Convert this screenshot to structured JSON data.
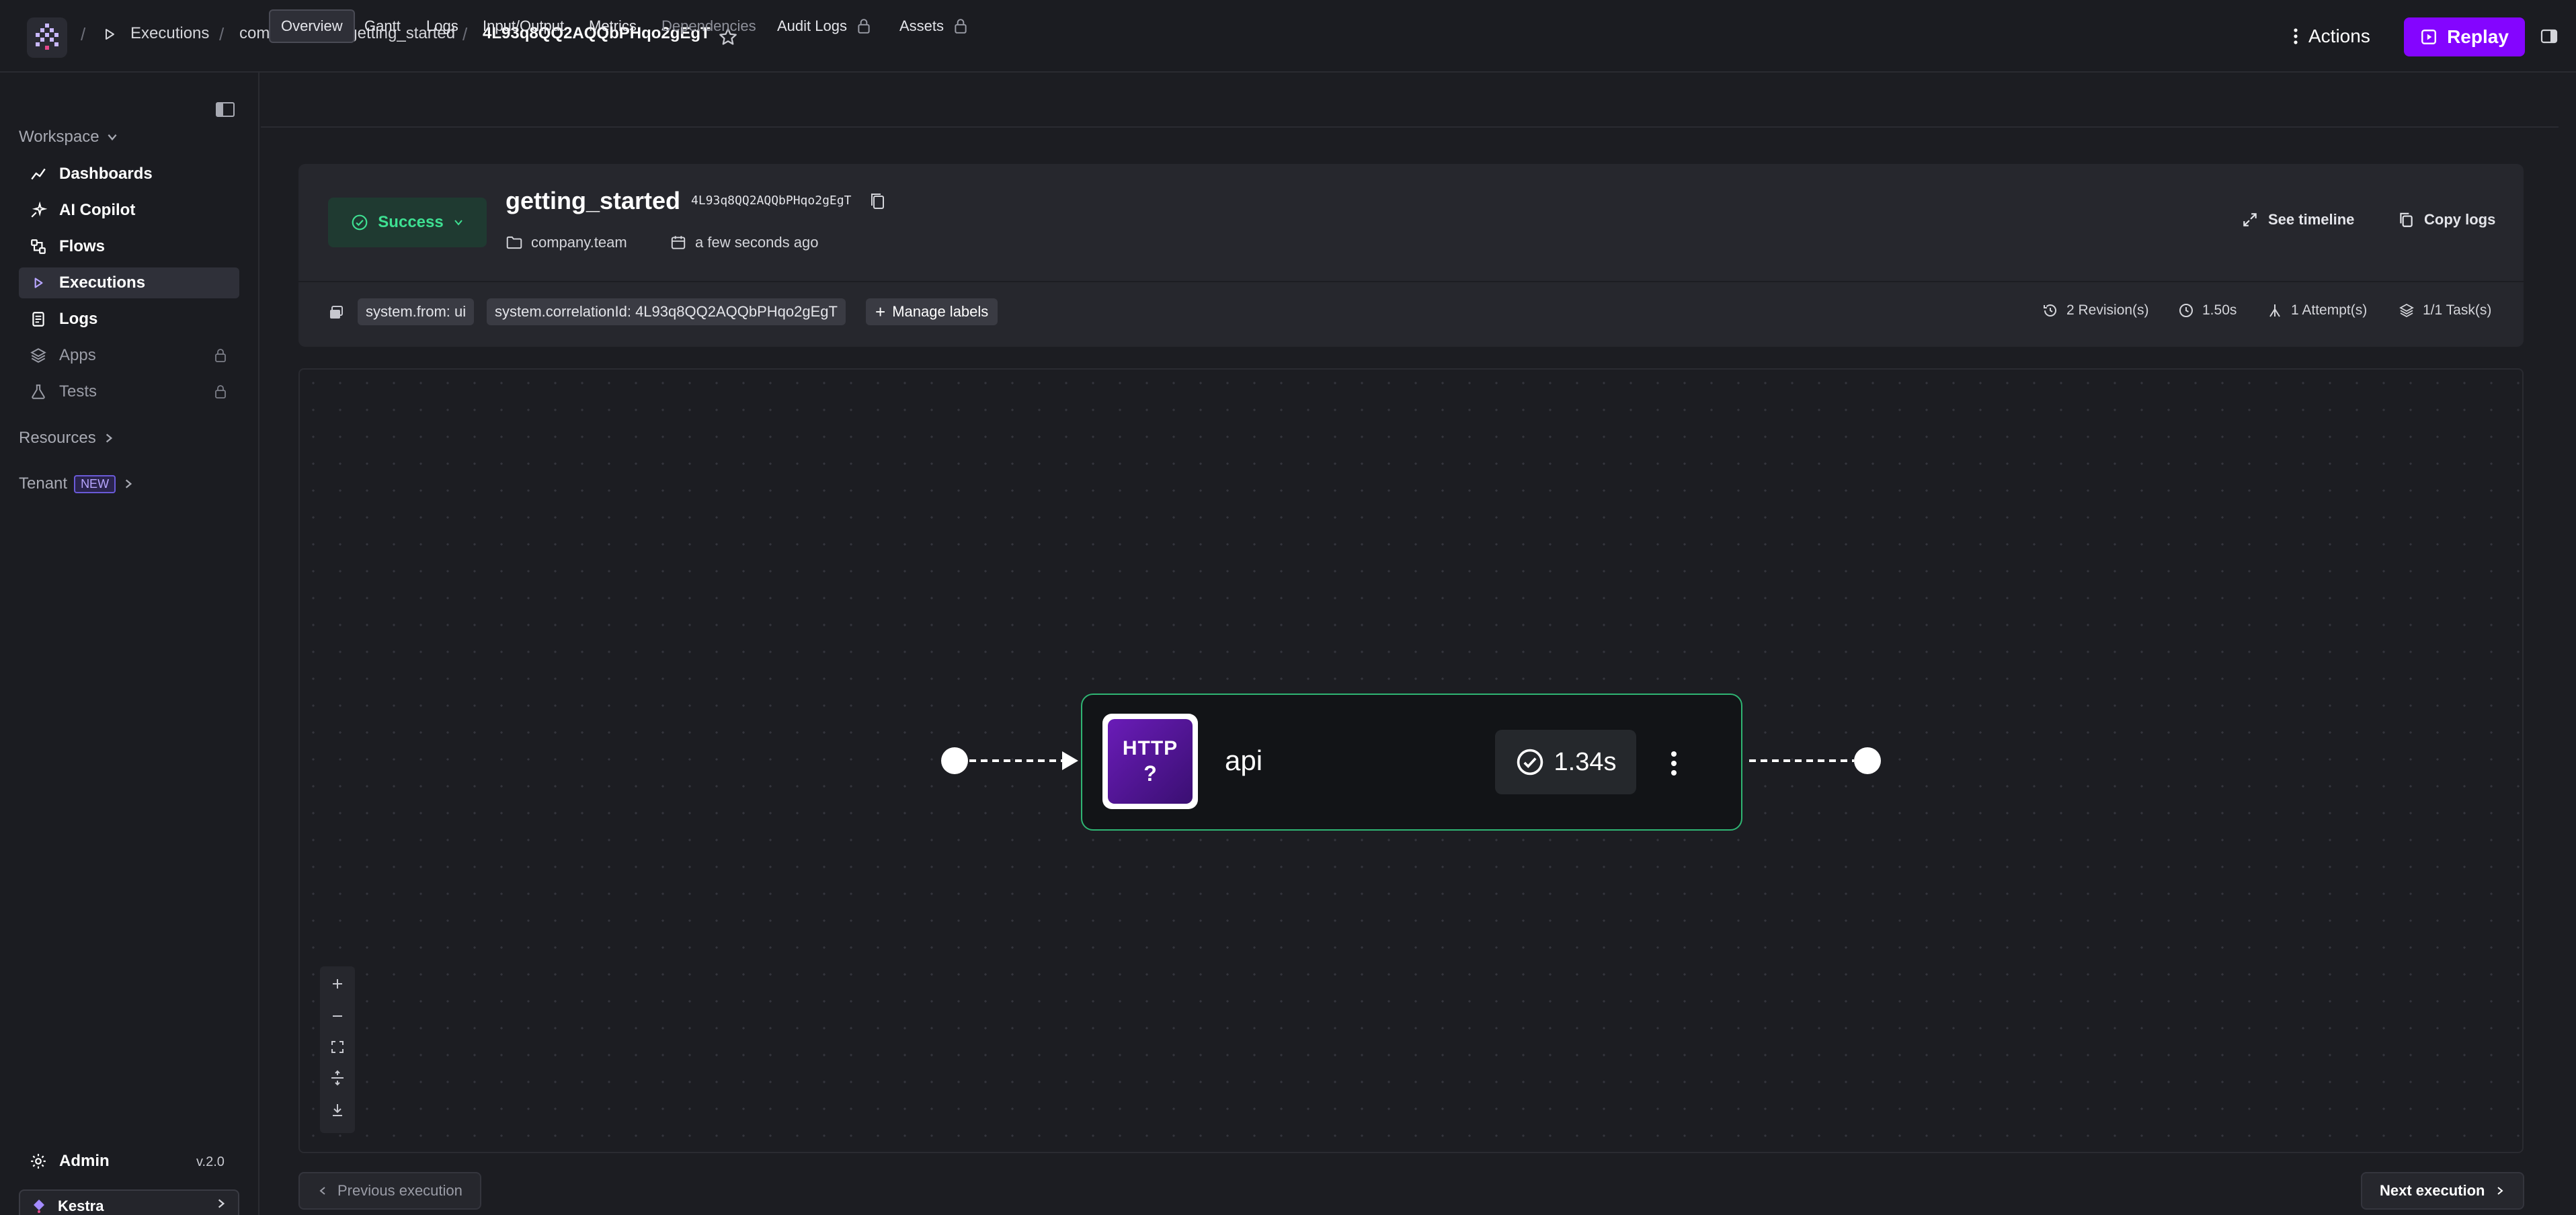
{
  "header": {
    "breadcrumbs": [
      "Executions",
      "company.team.getting_started",
      "4L93q8QQ2AQQbPHqo2gEgT"
    ],
    "actions_label": "Actions",
    "replay_label": "Replay"
  },
  "sidebar": {
    "workspace_label": "Workspace",
    "items": [
      {
        "label": "Dashboards",
        "icon": "chart-line-icon"
      },
      {
        "label": "AI Copilot",
        "icon": "sparkle-icon"
      },
      {
        "label": "Flows",
        "icon": "flow-icon"
      },
      {
        "label": "Executions",
        "icon": "play-icon",
        "active": true
      },
      {
        "label": "Logs",
        "icon": "document-icon"
      },
      {
        "label": "Apps",
        "icon": "layers-icon",
        "locked": true
      },
      {
        "label": "Tests",
        "icon": "flask-icon",
        "locked": true
      }
    ],
    "resources_label": "Resources",
    "tenant_label": "Tenant",
    "tenant_badge": "NEW",
    "admin_label": "Admin",
    "version": "v.2.0",
    "tenant_name": "Kestra"
  },
  "tabs": [
    {
      "label": "Overview",
      "active": true
    },
    {
      "label": "Gantt"
    },
    {
      "label": "Logs"
    },
    {
      "label": "Input/Output"
    },
    {
      "label": "Metrics"
    },
    {
      "label": "Dependencies",
      "disabled": true
    },
    {
      "label": "Audit Logs",
      "locked": true
    },
    {
      "label": "Assets",
      "locked": true
    }
  ],
  "execution": {
    "status": "Success",
    "flow_id": "getting_started",
    "execution_id": "4L93q8QQ2AQQbPHqo2gEgT",
    "namespace": "company.team",
    "started": "a few seconds ago",
    "see_timeline_label": "See timeline",
    "copy_logs_label": "Copy logs",
    "labels": [
      "system.from: ui",
      "system.correlationId: 4L93q8QQ2AQQbPHqo2gEgT"
    ],
    "manage_labels_label": "Manage labels",
    "stats": {
      "revisions": "2 Revision(s)",
      "duration": "1.50s",
      "attempts": "1 Attempt(s)",
      "tasks": "1/1 Task(s)"
    },
    "status_color": "#3ee092"
  },
  "topology": {
    "task": {
      "name": "api",
      "icon_text_top": "HTTP",
      "icon_text_bottom": "?",
      "duration": "1.34s",
      "border_color": "#2fb573"
    }
  },
  "footer": {
    "previous_label": "Previous execution",
    "next_label": "Next execution"
  },
  "colors": {
    "accent": "#8405ff",
    "background": "#1c1d22",
    "success": "#3ee092"
  }
}
